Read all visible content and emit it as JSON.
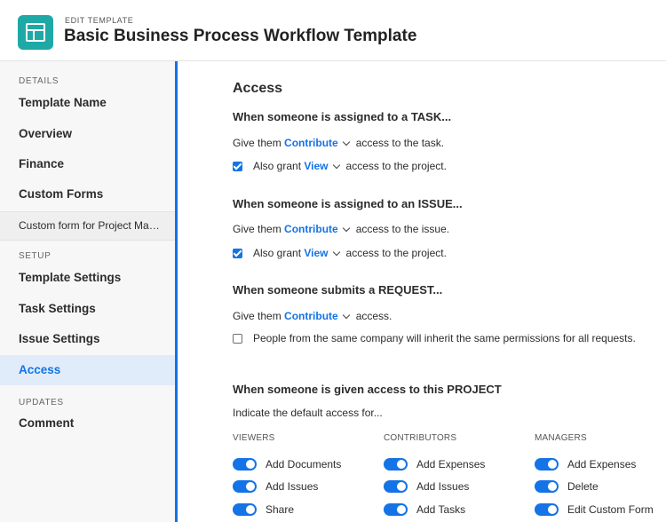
{
  "header": {
    "eyebrow": "EDIT TEMPLATE",
    "title": "Basic Business Process Workflow Template",
    "logo_icon": "template-layout-icon",
    "brand_color": "#1ea9a6"
  },
  "sidebar": {
    "details_label": "DETAILS",
    "setup_label": "SETUP",
    "updates_label": "UPDATES",
    "items": [
      "Template Name",
      "Overview",
      "Finance",
      "Custom Forms",
      "Custom form for Project Mater...",
      "Template Settings",
      "Task Settings",
      "Issue Settings",
      "Access",
      "Comment"
    ],
    "active": "Access",
    "accent_color": "#1473e6"
  },
  "main": {
    "title": "Access",
    "task": {
      "heading": "When someone is assigned to a TASK...",
      "give_prefix": "Give them",
      "give_value": "Contribute",
      "give_suffix": "access to the task.",
      "grant_prefix": "Also grant",
      "grant_value": "View",
      "grant_suffix": "access to the project.",
      "grant_checked": true
    },
    "issue": {
      "heading": "When someone is assigned to an ISSUE...",
      "give_prefix": "Give them",
      "give_value": "Contribute",
      "give_suffix": "access to the issue.",
      "grant_prefix": "Also grant",
      "grant_value": "View",
      "grant_suffix": "access to the project.",
      "grant_checked": true
    },
    "request": {
      "heading": "When someone submits a REQUEST...",
      "give_prefix": "Give them",
      "give_value": "Contribute",
      "give_suffix": "access.",
      "inherit_label": "People from the same company will inherit the same permissions for all requests.",
      "inherit_checked": false
    },
    "project": {
      "heading": "When someone is given access to this PROJECT",
      "intro": "Indicate the default access for...",
      "viewers": {
        "label": "VIEWERS",
        "toggles": [
          "Add Documents",
          "Add Issues",
          "Share"
        ]
      },
      "contributors": {
        "label": "CONTRIBUTORS",
        "toggles": [
          "Add Expenses",
          "Add Issues",
          "Add Tasks"
        ]
      },
      "managers": {
        "label": "MANAGERS",
        "toggles": [
          "Add Expenses",
          "Delete",
          "Edit Custom Form"
        ]
      }
    }
  }
}
